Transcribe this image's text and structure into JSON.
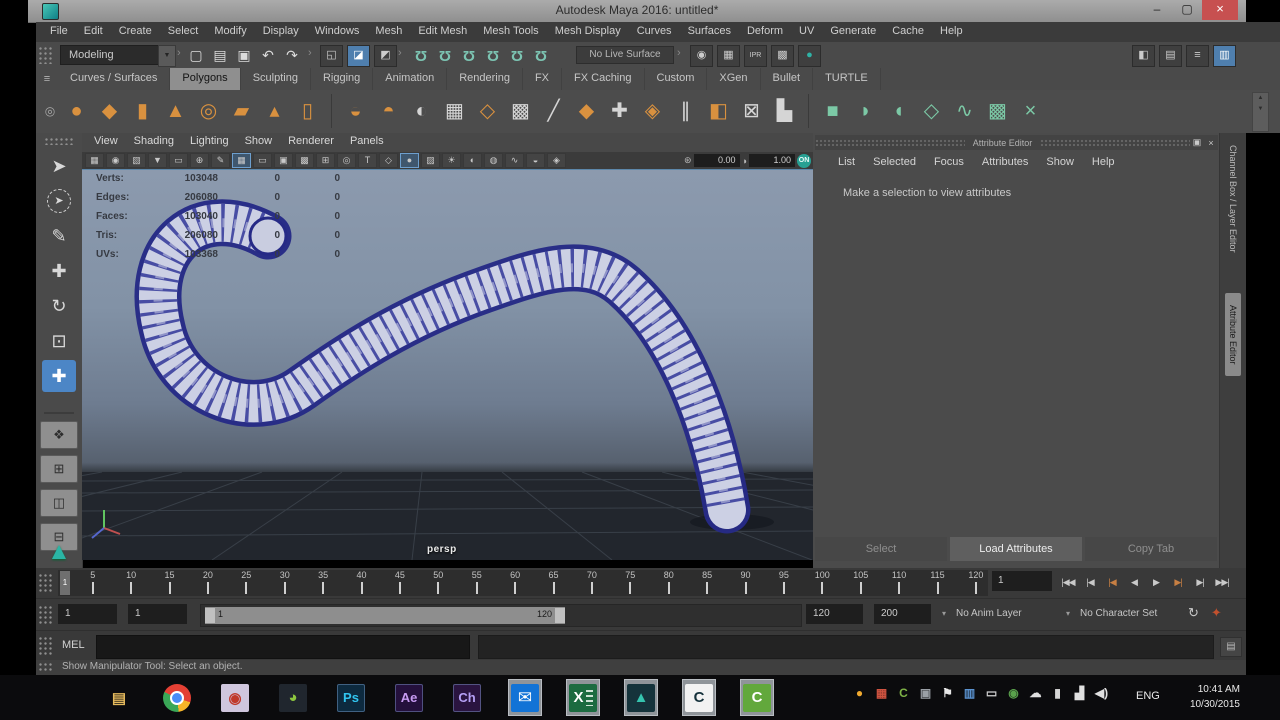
{
  "window": {
    "title": "Autodesk Maya 2016: untitled*",
    "controls": [
      {
        "name": "minimize",
        "glyph": "–"
      },
      {
        "name": "maximize",
        "glyph": "▢"
      },
      {
        "name": "close",
        "glyph": "×"
      }
    ]
  },
  "menu_bar": {
    "items": [
      "File",
      "Edit",
      "Create",
      "Select",
      "Modify",
      "Display",
      "Windows",
      "Mesh",
      "Edit Mesh",
      "Mesh Tools",
      "Mesh Display",
      "Curves",
      "Surfaces",
      "Deform",
      "UV",
      "Generate",
      "Cache",
      "Help"
    ]
  },
  "status_line": {
    "menu_set": "Modeling",
    "menu_set_arrow": "▼",
    "live_surface": "No Live Surface",
    "file_icons": [
      {
        "name": "new-scene",
        "glyph": "▢"
      },
      {
        "name": "open-scene",
        "glyph": "▤"
      },
      {
        "name": "save-scene",
        "glyph": "▣"
      },
      {
        "name": "undo",
        "glyph": "↶"
      },
      {
        "name": "redo",
        "glyph": "↷"
      }
    ],
    "selection_masks": [
      {
        "name": "select-by-hierarchy",
        "glyph": "◱"
      },
      {
        "name": "select-by-object",
        "glyph": "◪",
        "active": true
      },
      {
        "name": "select-by-component",
        "glyph": "◩"
      }
    ],
    "snap_icons": [
      {
        "name": "snap-to-grid",
        "glyph": "Ω"
      },
      {
        "name": "snap-to-curve",
        "glyph": "Ω"
      },
      {
        "name": "snap-to-point",
        "glyph": "Ω"
      },
      {
        "name": "snap-to-projected-center",
        "glyph": "Ω"
      },
      {
        "name": "snap-to-view-plane",
        "glyph": "Ω"
      },
      {
        "name": "make-live",
        "glyph": "Ω"
      }
    ],
    "render_icons": [
      {
        "name": "open-render-view",
        "glyph": "◉"
      },
      {
        "name": "render-current-frame",
        "glyph": "▦"
      },
      {
        "name": "ipr-render",
        "glyph": "IPR",
        "small": true
      },
      {
        "name": "render-settings",
        "glyph": "▩"
      },
      {
        "name": "hypershade",
        "glyph": "●",
        "color": "#2fb3a6"
      }
    ],
    "right_icons": [
      {
        "name": "modeling-toolkit",
        "glyph": "◧"
      },
      {
        "name": "raise-attribute-editor",
        "glyph": "▤"
      },
      {
        "name": "raise-tool-settings",
        "glyph": "≡"
      },
      {
        "name": "raise-channel-box",
        "glyph": "▥",
        "active": true
      }
    ]
  },
  "shelf": {
    "menu_icon": "≡",
    "gear_icon": "◎",
    "tabs": [
      {
        "label": "Curves / Surfaces"
      },
      {
        "label": "Polygons",
        "active": true
      },
      {
        "label": "Sculpting"
      },
      {
        "label": "Rigging"
      },
      {
        "label": "Animation"
      },
      {
        "label": "Rendering"
      },
      {
        "label": "FX"
      },
      {
        "label": "FX Caching"
      },
      {
        "label": "Custom"
      },
      {
        "label": "XGen"
      },
      {
        "label": "Bullet"
      },
      {
        "label": "TURTLE"
      }
    ],
    "icons": [
      {
        "name": "poly-sphere",
        "glyph": "●",
        "color": "#d9913f"
      },
      {
        "name": "poly-cube",
        "glyph": "◆",
        "color": "#d9913f"
      },
      {
        "name": "poly-cylinder",
        "glyph": "▮",
        "color": "#d9913f"
      },
      {
        "name": "poly-cone",
        "glyph": "▲",
        "color": "#d9913f"
      },
      {
        "name": "poly-torus",
        "glyph": "◎",
        "color": "#d9913f"
      },
      {
        "name": "poly-plane",
        "glyph": "▰",
        "color": "#d9913f"
      },
      {
        "name": "poly-pyramid",
        "glyph": "▴",
        "color": "#d9913f"
      },
      {
        "name": "poly-pipe",
        "glyph": "▯",
        "color": "#d9913f"
      },
      {
        "divider": true
      },
      {
        "name": "combine",
        "glyph": "◒",
        "color": "#d9913f"
      },
      {
        "name": "separate",
        "glyph": "◓",
        "color": "#d9913f"
      },
      {
        "name": "booleans",
        "glyph": "◐",
        "color": "#d5d5d5"
      },
      {
        "name": "fill-hole",
        "glyph": "▦",
        "color": "#d5d5d5"
      },
      {
        "name": "smooth",
        "glyph": "◇",
        "color": "#d9913f"
      },
      {
        "name": "subdivide",
        "glyph": "▩",
        "color": "#d5d5d5"
      },
      {
        "name": "multi-cut",
        "glyph": "╱",
        "color": "#d5d5d5"
      },
      {
        "name": "append-to-polygon",
        "glyph": "◆",
        "color": "#d9913f"
      },
      {
        "name": "sculpt",
        "glyph": "✚",
        "color": "#d5d5d5"
      },
      {
        "name": "extrude",
        "glyph": "◈",
        "color": "#d9913f"
      },
      {
        "name": "insert-edge-loop",
        "glyph": "∥",
        "color": "#d5d5d5"
      },
      {
        "name": "mirror",
        "glyph": "◧",
        "color": "#d9913f"
      },
      {
        "name": "crease",
        "glyph": "⊠",
        "color": "#d5d5d5"
      },
      {
        "name": "quad-draw",
        "glyph": "▙",
        "color": "#d5d5d5"
      },
      {
        "divider": true
      },
      {
        "name": "planar-mapping",
        "glyph": "■",
        "color": "#7cc9a6"
      },
      {
        "name": "cylindrical-mapping",
        "glyph": "◗",
        "color": "#7cc9a6"
      },
      {
        "name": "spherical-mapping",
        "glyph": "◖",
        "color": "#7cc9a6"
      },
      {
        "name": "automatic-mapping",
        "glyph": "◇",
        "color": "#7cc9a6"
      },
      {
        "name": "contour-stretch",
        "glyph": "∿",
        "color": "#7cc9a6"
      },
      {
        "name": "uv-editor",
        "glyph": "▩",
        "color": "#7cc9a6"
      },
      {
        "name": "cut-sew-uv",
        "glyph": "×",
        "color": "#7cc9a6"
      }
    ]
  },
  "toolbox": {
    "tools": [
      {
        "name": "select-tool",
        "glyph": "➤"
      },
      {
        "name": "lasso-select-tool",
        "glyph": "➤",
        "lasso": true
      },
      {
        "name": "paint-select-tool",
        "glyph": "✎"
      },
      {
        "name": "move-tool",
        "glyph": "✚"
      },
      {
        "name": "rotate-tool",
        "glyph": "↻"
      },
      {
        "name": "scale-tool",
        "glyph": "⊡"
      },
      {
        "name": "show-manipulator-tool",
        "glyph": "✚",
        "active": true
      }
    ],
    "layouts": [
      {
        "name": "layout-single-perspective",
        "glyph": "❖"
      },
      {
        "name": "layout-four-view",
        "glyph": "⊞"
      },
      {
        "name": "layout-persp-outliner",
        "glyph": "◫"
      },
      {
        "name": "layout-persp-graph",
        "glyph": "⊟"
      }
    ],
    "logo_glyph": "▲"
  },
  "viewport": {
    "menus": [
      "View",
      "Shading",
      "Lighting",
      "Show",
      "Renderer",
      "Panels"
    ],
    "toolbar_icons": [
      {
        "name": "select-camera",
        "glyph": "▦"
      },
      {
        "name": "lock-camera",
        "glyph": "◉"
      },
      {
        "name": "camera-attributes",
        "glyph": "▧"
      },
      {
        "name": "bookmarks",
        "glyph": "▼"
      },
      {
        "name": "image-plane",
        "glyph": "▭"
      },
      {
        "name": "two-d-pan-zoom",
        "glyph": "⊕"
      },
      {
        "name": "grease-pencil",
        "glyph": "✎"
      },
      {
        "name": "grid",
        "glyph": "▦",
        "active": true
      },
      {
        "name": "film-gate",
        "glyph": "▭"
      },
      {
        "name": "resolution-gate",
        "glyph": "▣"
      },
      {
        "name": "gate-mask",
        "glyph": "▩"
      },
      {
        "name": "field-chart",
        "glyph": "⊞"
      },
      {
        "name": "safe-action",
        "glyph": "◎"
      },
      {
        "name": "safe-title",
        "glyph": "T"
      },
      {
        "name": "wireframe",
        "glyph": "◇"
      },
      {
        "name": "smooth-shade-all",
        "glyph": "●",
        "active": true
      },
      {
        "name": "textured",
        "glyph": "▨"
      },
      {
        "name": "use-all-lights",
        "glyph": "☀"
      },
      {
        "name": "shadows",
        "glyph": "◐"
      },
      {
        "name": "screen-space-ao",
        "glyph": "◍"
      },
      {
        "name": "motion-blur",
        "glyph": "∿"
      },
      {
        "name": "xray",
        "glyph": "◒"
      },
      {
        "name": "isolate-select",
        "glyph": "◈"
      }
    ],
    "exposure_icon": "⊛",
    "exposure_value": "0.00",
    "gamma_icon": "◑",
    "gamma_value": "1.00",
    "color_mgmt_label": "ON",
    "camera_label": "persp",
    "hud": {
      "rows": [
        {
          "label": "Verts:",
          "c1": "103048",
          "c2": "0",
          "c3": "0"
        },
        {
          "label": "Edges:",
          "c1": "206080",
          "c2": "0",
          "c3": "0"
        },
        {
          "label": "Faces:",
          "c1": "103040",
          "c2": "0",
          "c3": "0"
        },
        {
          "label": "Tris:",
          "c1": "206080",
          "c2": "0",
          "c3": "0"
        },
        {
          "label": "UVs:",
          "c1": "103368",
          "c2": "0",
          "c3": "0"
        }
      ]
    },
    "object_colors": {
      "wireframe": "#262a86",
      "surface": "#ccd0e4"
    }
  },
  "attribute_editor": {
    "title": "Attribute Editor",
    "float_icon": "▣",
    "close_icon": "×",
    "menus": [
      "List",
      "Selected",
      "Focus",
      "Attributes",
      "Show",
      "Help"
    ],
    "message": "Make a selection to view attributes",
    "buttons": [
      {
        "label": "Select"
      },
      {
        "label": "Load Attributes",
        "primary": true
      },
      {
        "label": "Copy Tab"
      }
    ],
    "side_tabs": [
      {
        "label": "Channel Box / Layer Editor"
      },
      {
        "label": "Attribute Editor",
        "active": true
      }
    ]
  },
  "timeline": {
    "ticks": [
      5,
      10,
      15,
      20,
      25,
      30,
      35,
      40,
      45,
      50,
      55,
      60,
      65,
      70,
      75,
      80,
      85,
      90,
      95,
      100,
      105,
      110,
      115,
      120
    ],
    "marker_label": "1",
    "current_frame": "1",
    "playback": [
      {
        "name": "go-to-start",
        "glyph": "|◀◀"
      },
      {
        "name": "step-back-frame",
        "glyph": "|◀"
      },
      {
        "name": "step-back-key",
        "glyph": "|◀",
        "accent": true
      },
      {
        "name": "play-backwards",
        "glyph": "◀"
      },
      {
        "name": "play-forwards",
        "glyph": "▶"
      },
      {
        "name": "step-forward-key",
        "glyph": "▶|",
        "accent": true
      },
      {
        "name": "step-forward-frame",
        "glyph": "▶|"
      },
      {
        "name": "go-to-end",
        "glyph": "▶▶|"
      }
    ]
  },
  "range_slider": {
    "start_time": "1",
    "playback_start": "1",
    "bar_start": "1",
    "bar_end": "120",
    "playback_end": "120",
    "end_time": "200",
    "anim_layer": "No Anim Layer",
    "character_set": "No Character Set",
    "icons": [
      {
        "name": "anim-layer-refresh",
        "glyph": "↻",
        "color": "#c9c9c9"
      },
      {
        "name": "auto-keyframe",
        "glyph": "✦",
        "color": "#c2512e"
      }
    ]
  },
  "command_line": {
    "label": "MEL",
    "input_value": "",
    "script_editor_icon": "▤"
  },
  "help_line": {
    "text": "Show Manipulator Tool: Select an object."
  },
  "taskbar": {
    "apps": [
      {
        "name": "start",
        "cls": "win",
        "label": ""
      },
      {
        "name": "file-explorer",
        "label": "▤",
        "fg": "#e4b95c",
        "bg": "transparent"
      },
      {
        "name": "chrome",
        "cls": "chrome",
        "label": ""
      },
      {
        "name": "screen-recorder",
        "label": "◉",
        "fg": "#c0392b",
        "bg": "#cfc6dd"
      },
      {
        "name": "photo-app",
        "label": "◕",
        "fg": "#8cc63f",
        "bg": "#20262e"
      },
      {
        "name": "photoshop",
        "cls": "adobe",
        "label": "Ps",
        "fg": "#31c5f0",
        "bg": "#0d2a3f"
      },
      {
        "name": "after-effects",
        "cls": "adobe",
        "label": "Ae",
        "fg": "#c79bf2",
        "bg": "#24103c"
      },
      {
        "name": "character-animator",
        "cls": "adobe",
        "label": "Ch",
        "fg": "#b5a0f5",
        "bg": "#2a1440"
      },
      {
        "name": "mail",
        "cls": "mailic",
        "label": "✉",
        "fg": "#ffffff",
        "bg": "#1273d6",
        "active": true
      },
      {
        "name": "excel",
        "cls": "excel",
        "label": "X",
        "fg": "#ffffff",
        "bg": "#1c6b40",
        "active": true
      },
      {
        "name": "maya",
        "label": "▲",
        "fg": "#35c4ae",
        "bg": "#15333b",
        "active": true
      },
      {
        "name": "camtasia-recorder",
        "label": "C",
        "fg": "#16323c",
        "bg": "#f2f2f2",
        "active": true
      },
      {
        "name": "camtasia-studio",
        "label": "C",
        "fg": "#ffffff",
        "bg": "#62a83c",
        "active": true
      }
    ],
    "tray": [
      {
        "name": "java-update",
        "glyph": "●",
        "color": "#f0a92f"
      },
      {
        "name": "color-utility",
        "glyph": "▦",
        "color": "#cf5340"
      },
      {
        "name": "camtasia-tray",
        "glyph": "C",
        "color": "#7fb347"
      },
      {
        "name": "usb-device",
        "glyph": "▣",
        "color": "#9aa0a6"
      },
      {
        "name": "action-center-flag",
        "glyph": "⚑",
        "color": "#e8e8e8"
      },
      {
        "name": "tablet-driver",
        "glyph": "▥",
        "color": "#5b93d0"
      },
      {
        "name": "display-settings",
        "glyph": "▭",
        "color": "#cfcfcf"
      },
      {
        "name": "graphics-utility",
        "glyph": "◉",
        "color": "#5aa14c"
      },
      {
        "name": "cloud-sync",
        "glyph": "☁",
        "color": "#e0e0e0"
      },
      {
        "name": "power",
        "glyph": "▮",
        "color": "#d6d6d6"
      },
      {
        "name": "network",
        "glyph": "▟",
        "color": "#e0e0e0"
      },
      {
        "name": "volume",
        "glyph": "◀)",
        "color": "#e0e0e0"
      }
    ],
    "language": "ENG",
    "time": "10:41 AM",
    "date": "10/30/2015"
  }
}
